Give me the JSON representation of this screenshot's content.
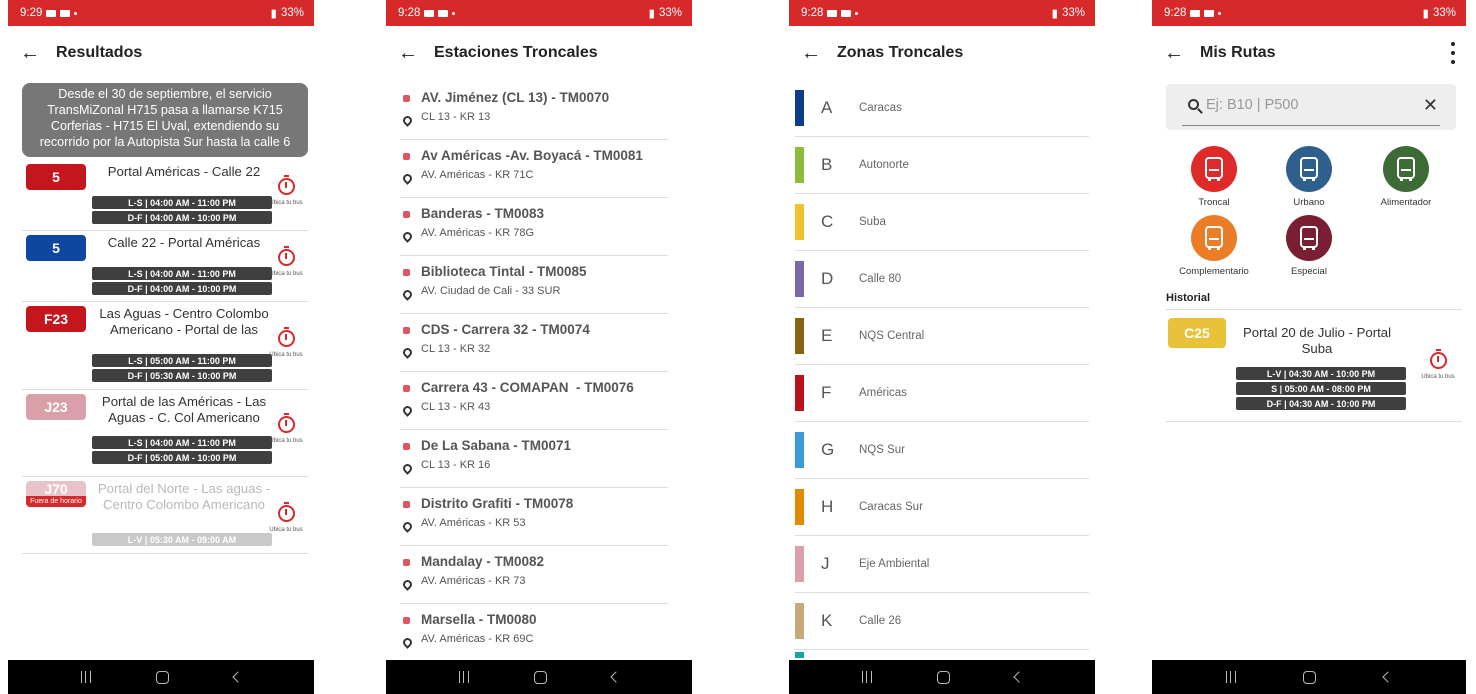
{
  "statusbar": {
    "p1": {
      "time": "9:29",
      "right": "33%"
    },
    "p2": {
      "time": "9:28",
      "right": "33%"
    },
    "p3": {
      "time": "9:28",
      "right": "33%"
    },
    "p4": {
      "time": "9:28",
      "right": "33%"
    }
  },
  "screens": {
    "results": {
      "title": "Resultados",
      "notice": "Desde el 30 de septiembre, el servicio TransMiZonal H715 pasa a llamarse K715 Corferias - H715 El Uval, extendiendo su recorrido por la Autopista Sur hasta la calle 6",
      "locate_label": "Ubica tu bus",
      "out_of_schedule": "Fuera de horario",
      "routes": [
        {
          "code": "5",
          "name": "Portal Américas - Calle 22",
          "color": "#c4161c",
          "sched": [
            "L-S | 04:00 AM - 11:00 PM",
            "D-F | 04:00 AM - 10:00 PM"
          ]
        },
        {
          "code": "5",
          "name": "Calle 22 - Portal Américas",
          "color": "#0d47a1",
          "sched": [
            "L-S | 04:00 AM - 11:00 PM",
            "D-F | 04:00 AM - 10:00 PM"
          ]
        },
        {
          "code": "F23",
          "name": "Las Aguas - Centro Colombo Americano - Portal de las",
          "color": "#c4161c",
          "sched": [
            "L-S | 05:00 AM - 11:00 PM",
            "D-F | 05:30 AM - 10:00 PM"
          ]
        },
        {
          "code": "J23",
          "name": "Portal de las Américas - Las Aguas - C. Col Americano",
          "color": "#d9a0aa",
          "sched": [
            "L-S | 04:00 AM - 11:00 PM",
            "D-F | 05:00 AM - 10:00 PM"
          ]
        },
        {
          "code": "J70",
          "name": "Portal del Norte - Las aguas - Centro Colombo Americano",
          "color": "#d9a0aa",
          "sched": [
            "L-V | 05:30 AM - 09:00 AM"
          ]
        }
      ]
    },
    "stations": {
      "title": "Estaciones Troncales",
      "items": [
        {
          "name": "AV. Jiménez (CL 13) - TM0070",
          "addr": "CL 13 - KR 13"
        },
        {
          "name": "Av Américas -Av. Boyacá - TM0081",
          "addr": "AV. Américas - KR 71C"
        },
        {
          "name": "Banderas - TM0083",
          "addr": "AV. Américas - KR 78G"
        },
        {
          "name": "Biblioteca Tintal - TM0085",
          "addr": "AV. Ciudad de Cali - 33 SUR"
        },
        {
          "name": "CDS - Carrera 32 - TM0074",
          "addr": "CL 13 - KR 32"
        },
        {
          "name": "Carrera 43 - COMAPAN  - TM0076",
          "addr": "CL 13 - KR 43"
        },
        {
          "name": "De La Sabana - TM0071",
          "addr": "CL 13 - KR 16"
        },
        {
          "name": "Distrito Grafiti - TM0078",
          "addr": "AV. Américas - KR 53"
        },
        {
          "name": "Mandalay - TM0082",
          "addr": "AV. Américas - KR 73"
        },
        {
          "name": "Marsella - TM0080",
          "addr": "AV. Américas - KR 69C"
        }
      ]
    },
    "zones": {
      "title": "Zonas Troncales",
      "items": [
        {
          "letter": "A",
          "name": "Caracas",
          "color": "#0d3c8c"
        },
        {
          "letter": "B",
          "name": "Autonorte",
          "color": "#8dbb3c"
        },
        {
          "letter": "C",
          "name": "Suba",
          "color": "#f2c12e"
        },
        {
          "letter": "D",
          "name": "Calle 80",
          "color": "#7b68a6"
        },
        {
          "letter": "E",
          "name": "NQS Central",
          "color": "#8a6310"
        },
        {
          "letter": "F",
          "name": "Américas",
          "color": "#b5121b"
        },
        {
          "letter": "G",
          "name": "NQS Sur",
          "color": "#3b9ad9"
        },
        {
          "letter": "H",
          "name": "Caracas Sur",
          "color": "#e08a00"
        },
        {
          "letter": "J",
          "name": "Eje Ambiental",
          "color": "#d9a0aa"
        },
        {
          "letter": "K",
          "name": "Calle 26",
          "color": "#c9a97c"
        }
      ]
    },
    "myroutes": {
      "title": "Mis Rutas",
      "search_placeholder": "Ej: B10 | P500",
      "categories": [
        {
          "label": "Troncal",
          "color": "#e02a2a"
        },
        {
          "label": "Urbano",
          "color": "#2f5f8c"
        },
        {
          "label": "Alimentador",
          "color": "#3d6b35"
        },
        {
          "label": "Complementario",
          "color": "#ea7d26"
        },
        {
          "label": "Especial",
          "color": "#7a1f33"
        }
      ],
      "history_title": "Historial",
      "history": {
        "code": "C25",
        "name": "Portal 20 de Julio - Portal Suba",
        "color": "#e8c23a",
        "sched": [
          "L-V | 04:30 AM - 10:00 PM",
          "S | 05:00 AM - 08:00 PM",
          "D-F | 04:30 AM - 10:00 PM"
        ],
        "locate_label": "Ubica tu bus"
      }
    }
  }
}
